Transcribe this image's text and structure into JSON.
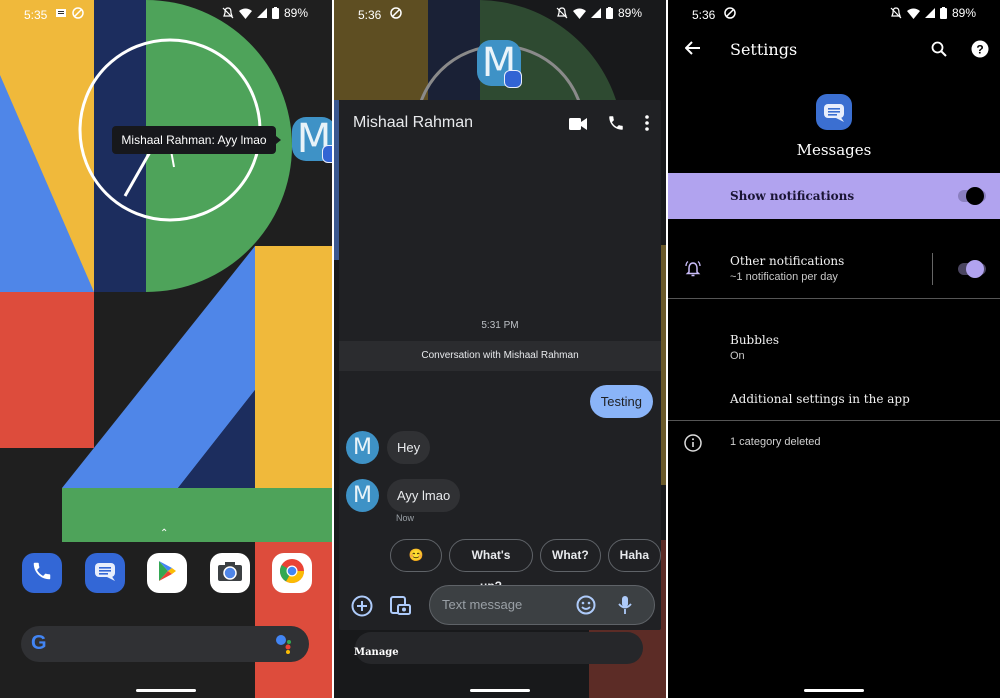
{
  "panels": {
    "home": {
      "status": {
        "time": "5:35",
        "battery": "89%"
      },
      "tooltip": "Mishaal Rahman: Ayy lmao",
      "bubble_letter": "M",
      "dock_apps": [
        {
          "name": "Phone",
          "icon": "phone-icon"
        },
        {
          "name": "Messages",
          "icon": "messages-icon"
        },
        {
          "name": "Play Store",
          "icon": "play-store-icon"
        },
        {
          "name": "Camera",
          "icon": "camera-icon"
        },
        {
          "name": "Chrome",
          "icon": "chrome-icon"
        }
      ],
      "search_logo": "G"
    },
    "chat": {
      "status": {
        "time": "5:36",
        "battery": "89%"
      },
      "bubble_letter": "M",
      "title": "Mishaal Rahman",
      "timestamp": "5:31 PM",
      "banner": "Conversation with Mishaal Rahman",
      "messages": [
        {
          "direction": "outgoing",
          "text": "Testing"
        },
        {
          "direction": "incoming",
          "avatar": "M",
          "text": "Hey"
        },
        {
          "direction": "incoming",
          "avatar": "M",
          "text": "Ayy lmao",
          "time": "Now"
        }
      ],
      "smart_replies": [
        "😊",
        "What's up?",
        "What?",
        "Haha"
      ],
      "compose_placeholder": "Text message",
      "manage_label": "Manage"
    },
    "settings": {
      "status": {
        "time": "5:36",
        "battery": "89%"
      },
      "toolbar_title": "Settings",
      "app_name": "Messages",
      "show_notifications": {
        "label": "Show notifications",
        "enabled": true
      },
      "other_notifications": {
        "title": "Other notifications",
        "subtitle": "~1 notification per day",
        "enabled": true
      },
      "bubbles": {
        "title": "Bubbles",
        "subtitle": "On"
      },
      "additional": "Additional settings in the app",
      "footer": "1 category deleted"
    }
  },
  "colors": {
    "accent_purple": "#b1a3ef",
    "bubble_blue": "#3e92c6",
    "outgoing_bubble": "#8ab4f8",
    "messages_blue": "#3b6fd1"
  }
}
